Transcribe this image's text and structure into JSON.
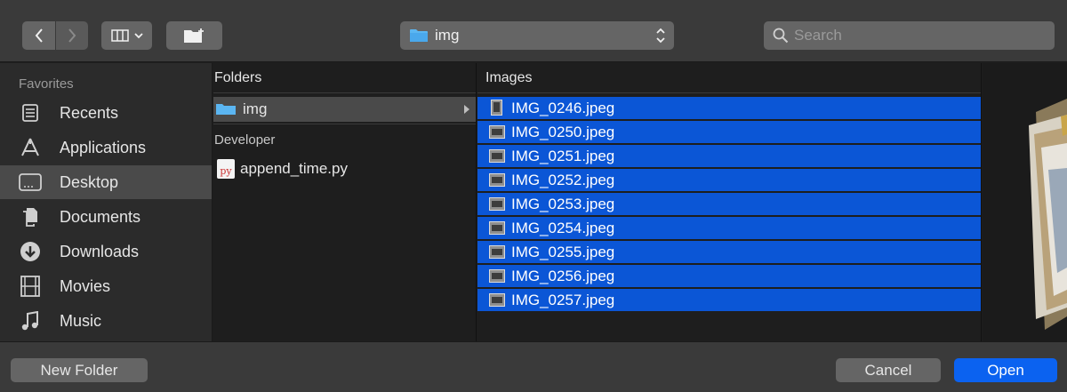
{
  "toolbar": {
    "back_icon": "chevron-left-icon",
    "forward_icon": "chevron-right-icon",
    "view_icon": "column-view-icon",
    "new_folder_icon": "new-folder-icon",
    "path": "img",
    "search_placeholder": "Search"
  },
  "sidebar": {
    "heading": "Favorites",
    "items": [
      {
        "label": "Recents",
        "icon": "recents-icon"
      },
      {
        "label": "Applications",
        "icon": "applications-icon"
      },
      {
        "label": "Desktop",
        "icon": "desktop-icon",
        "selected": true
      },
      {
        "label": "Documents",
        "icon": "documents-icon"
      },
      {
        "label": "Downloads",
        "icon": "downloads-icon"
      },
      {
        "label": "Movies",
        "icon": "movies-icon"
      },
      {
        "label": "Music",
        "icon": "music-icon"
      }
    ]
  },
  "folders_column": {
    "header": "Folders",
    "selected_folder": "img",
    "group_label": "Developer",
    "file": "append_time.py",
    "file_icon_text": "py"
  },
  "images_column": {
    "header": "Images",
    "files": [
      "IMG_0246.jpeg",
      "IMG_0250.jpeg",
      "IMG_0251.jpeg",
      "IMG_0252.jpeg",
      "IMG_0253.jpeg",
      "IMG_0254.jpeg",
      "IMG_0255.jpeg",
      "IMG_0256.jpeg",
      "IMG_0257.jpeg"
    ]
  },
  "footer": {
    "new_folder": "New Folder",
    "cancel": "Cancel",
    "open": "Open"
  },
  "colors": {
    "selection": "#0b56d6",
    "primary_button": "#0b62f0",
    "toolbar": "#3a3a3a"
  }
}
